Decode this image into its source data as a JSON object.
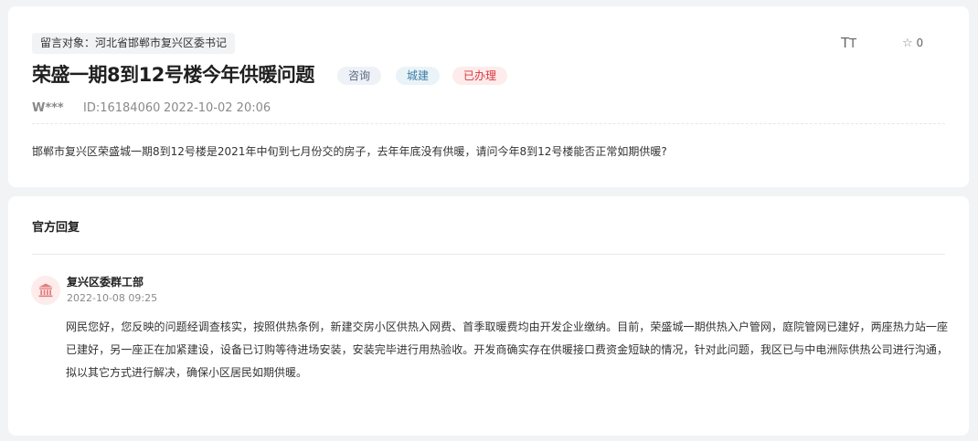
{
  "message": {
    "recipient": "留言对象：河北省邯郸市复兴区委书记",
    "title": "荣盛一期8到12号楼今年供暖问题",
    "tags": [
      {
        "label": "咨询",
        "color": "#5a6a85"
      },
      {
        "label": "城建",
        "color": "#3d7ea6"
      },
      {
        "label": "已办理",
        "color": "#d9363e"
      }
    ],
    "user": "W***",
    "id": "ID:16184060",
    "time": "2022-10-02 20:06",
    "content": "邯郸市复兴区荣盛城一期8到12号楼是2021年中旬到七月份交的房子，去年年底没有供暖，请问今年8到12号楼能否正常如期供暖?"
  },
  "actions": {
    "font_size_label_big": "T",
    "font_size_label_small": "T",
    "star_icon": "star-icon",
    "star_count": "0"
  },
  "reply": {
    "heading": "官方回复",
    "department": "复兴区委群工部",
    "department_icon": "government-building-icon",
    "time": "2022-10-08 09:25",
    "body": "网民您好，您反映的问题经调查核实，按照供热条例，新建交房小区供热入网费、首季取暖费均由开发企业缴纳。目前，荣盛城一期供热入户管网，庭院管网已建好，两座热力站一座已建好，另一座正在加紧建设，设备已订购等待进场安装，安装完毕进行用热验收。开发商确实存在供暖接口费资金短缺的情况，针对此问题，我区已与中电洲际供热公司进行沟通，拟以其它方式进行解决，确保小区居民如期供暖。"
  }
}
